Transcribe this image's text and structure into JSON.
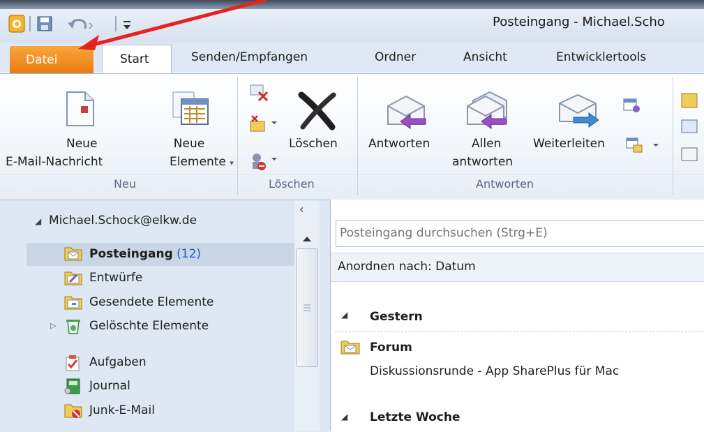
{
  "window": {
    "title": "Posteingang - Michael.Scho"
  },
  "tabs": [
    "Datei",
    "Start",
    "Senden/Empfangen",
    "Ordner",
    "Ansicht",
    "Entwicklertools"
  ],
  "ribbon": {
    "neu": {
      "new_mail_line1": "Neue",
      "new_mail_line2": "E-Mail-Nachricht",
      "new_items_line1": "Neue",
      "new_items_line2": "Elemente",
      "group_label": "Neu"
    },
    "loeschen": {
      "delete_label": "Löschen",
      "group_label": "Löschen"
    },
    "antworten": {
      "reply": "Antworten",
      "reply_all_line1": "Allen",
      "reply_all_line2": "antworten",
      "forward": "Weiterleiten",
      "group_label": "Antworten"
    }
  },
  "nav": {
    "account": "Michael.Schock@elkw.de",
    "folders": [
      {
        "label": "Posteingang",
        "count": "(12)"
      },
      {
        "label": "Entwürfe"
      },
      {
        "label": "Gesendete Elemente"
      },
      {
        "label": "Gelöschte Elemente"
      },
      {
        "label": "Aufgaben"
      },
      {
        "label": "Journal"
      },
      {
        "label": "Junk-E-Mail"
      }
    ]
  },
  "mail": {
    "search_placeholder": "Posteingang durchsuchen (Strg+E)",
    "sort_label": "Anordnen nach: Datum",
    "groups": [
      {
        "header": "Gestern",
        "items": [
          {
            "sender": "Forum",
            "subject": "Diskussionsrunde - App SharePlus für Mac"
          }
        ]
      },
      {
        "header": "Letzte Woche"
      }
    ]
  },
  "colors": {
    "datei_tab": "#ea7a10",
    "annotation_arrow": "#e8231d",
    "unread_count": "#1a5fd0"
  },
  "icons": [
    "outlook-logo-icon",
    "save-icon",
    "undo-icon",
    "new-mail-icon",
    "new-items-icon",
    "ignore-icon",
    "cleanup-icon",
    "junk-icon",
    "delete-x-icon",
    "reply-icon",
    "reply-all-icon",
    "forward-icon",
    "meeting-icon",
    "more-respond-icon",
    "inbox-folder-icon",
    "drafts-icon",
    "sent-icon",
    "trash-icon",
    "tasks-icon",
    "journal-icon",
    "junk-folder-icon",
    "forum-folder-icon"
  ]
}
